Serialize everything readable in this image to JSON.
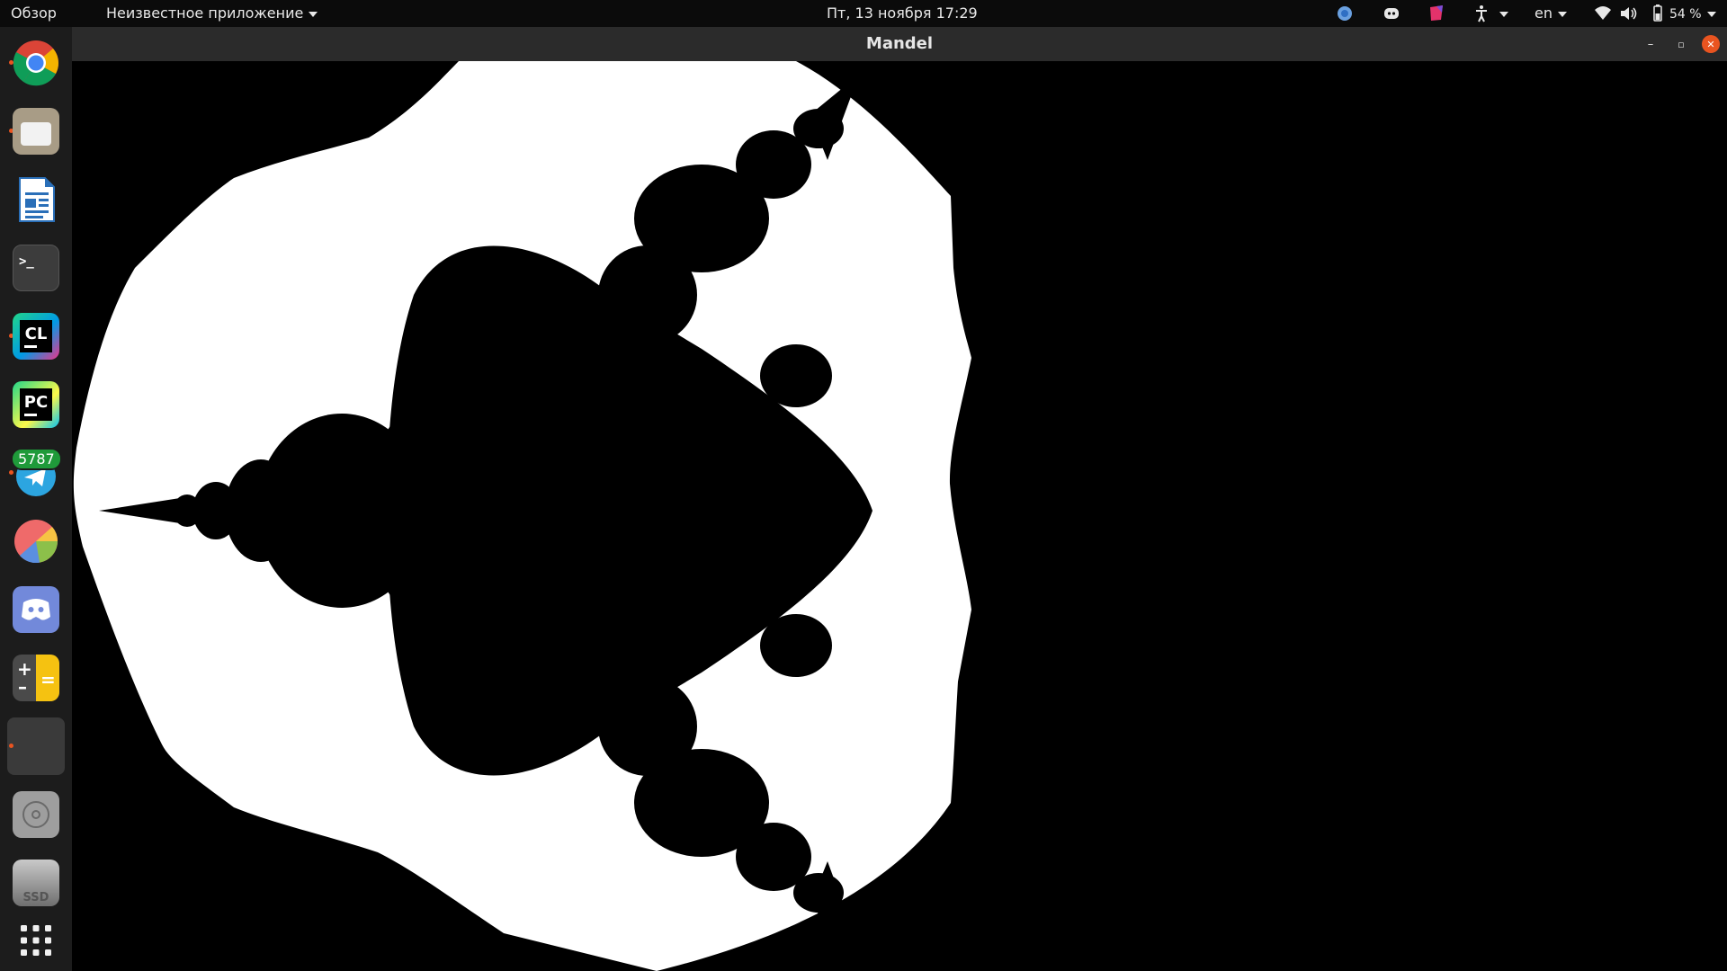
{
  "topbar": {
    "activities": "Обзор",
    "app_menu": "Неизвестное приложение",
    "clock": "Пт, 13 ноября  17:29",
    "language": "en",
    "battery": "54 %",
    "tray_icons": [
      "chrome-tray-icon",
      "discord-tray-icon",
      "jetbrains-toolbox-icon",
      "accessibility-icon",
      "wifi-icon",
      "volume-icon",
      "battery-icon",
      "system-menu-chevron-icon"
    ]
  },
  "dock": {
    "items": [
      {
        "name": "chrome",
        "running": true
      },
      {
        "name": "files",
        "running": true
      },
      {
        "name": "libreoffice-writer",
        "running": false
      },
      {
        "name": "terminal",
        "running": false
      },
      {
        "name": "clion",
        "label": "CL",
        "running": true
      },
      {
        "name": "pycharm",
        "label": "PC",
        "running": false
      },
      {
        "name": "telegram",
        "badge": "5787",
        "running": true
      },
      {
        "name": "disk-usage",
        "running": false
      },
      {
        "name": "discord",
        "running": false
      },
      {
        "name": "calculator",
        "running": false
      },
      {
        "name": "mandel-app",
        "running": true,
        "active": true
      },
      {
        "name": "optical-drive",
        "running": false
      },
      {
        "name": "ssd-drive",
        "label": "SSD",
        "running": false
      },
      {
        "name": "show-applications",
        "running": false
      }
    ]
  },
  "window": {
    "title": "Mandel",
    "minimize": "–",
    "maximize": "▫",
    "close": "✕"
  },
  "colors": {
    "accent": "#e95420",
    "close_button": "#e95420",
    "fractal_fill": "#000000",
    "fractal_background": "#ffffff"
  }
}
